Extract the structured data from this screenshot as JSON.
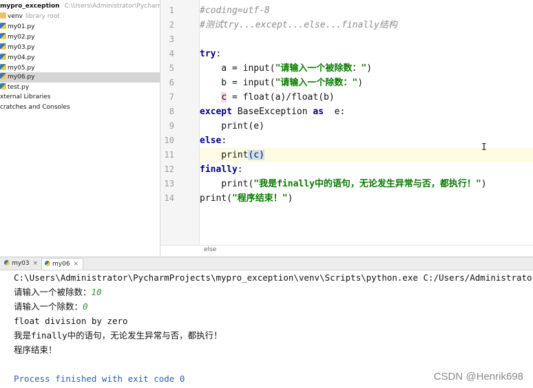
{
  "project": {
    "root_name": "mypro_exception",
    "root_path": "C:\\Users\\Administrator\\PycharmPro",
    "items": [
      {
        "label": "venv",
        "hint": "library root",
        "kind": "folder"
      },
      {
        "label": "my01.py",
        "kind": "py"
      },
      {
        "label": "my02.py",
        "kind": "py"
      },
      {
        "label": "my03.py",
        "kind": "py"
      },
      {
        "label": "my04.py",
        "kind": "py"
      },
      {
        "label": "my05.py",
        "kind": "py"
      },
      {
        "label": "my06.py",
        "kind": "py",
        "selected": true
      },
      {
        "label": "test.py",
        "kind": "py"
      },
      {
        "label": "xternal Libraries",
        "kind": "lib"
      },
      {
        "label": "cratches and Consoles",
        "kind": "lib"
      }
    ]
  },
  "editor": {
    "line_numbers": [
      "1",
      "2",
      "3",
      "4",
      "5",
      "6",
      "7",
      "8",
      "9",
      "10",
      "11",
      "12",
      "13",
      "14"
    ],
    "lines": {
      "l1": "#coding=utf-8",
      "l2": "#测试try...except...else...finally结构",
      "l4_kw": "try",
      "l4_rest": ":",
      "l5_pre": "    a = input(",
      "l5_str": "\"请输入一个被除数：\"",
      "l5_post": ")",
      "l6_pre": "    b = input(",
      "l6_str": "\"请输入一个除数：\"",
      "l6_post": ")",
      "l7_indent": "    ",
      "l7_sel": "c",
      "l7_rest": " = float(a)/float(b)",
      "l8_kw": "except",
      "l8_mid": " BaseException ",
      "l8_kw2": "as",
      "l8_rest": "  e:",
      "l9": "    print(e)",
      "l10_kw": "else",
      "l10_rest": ":",
      "l11_pre": "    print",
      "l11_hl": "(c)",
      "l12_kw": "finally",
      "l12_rest": ":",
      "l13_pre": "    print(",
      "l13_str": "\"我是finally中的语句，无论发生异常与否，都执行！\"",
      "l13_post": ")",
      "l14_pre": "print(",
      "l14_str": "\"程序结束！\"",
      "l14_post": ")"
    },
    "current_line": 11,
    "breadcrumb": "else",
    "cursor_glyph": "I"
  },
  "run": {
    "tabs": [
      {
        "label": "my03",
        "close": "×"
      },
      {
        "label": "my06",
        "close": "×"
      }
    ],
    "output": {
      "cmd": "C:\\Users\\Administrator\\PycharmProjects\\mypro_exception\\venv\\Scripts\\python.exe C:/Users/Administrator",
      "prompt1": "请输入一个被除数：",
      "input1": "10",
      "prompt2": "请输入一个除数：",
      "input2": "0",
      "error": "float division by zero",
      "finally_msg": "我是finally中的语句，无论发生异常与否，都执行！",
      "end_msg": "程序结束！",
      "exit": "Process finished with exit code 0"
    }
  },
  "watermark": "CSDN @Henrik698",
  "colors": {
    "keyword": "#000080",
    "string": "#0a7a00",
    "comment": "#8c8c8c",
    "user_input": "#2e8b2e"
  }
}
